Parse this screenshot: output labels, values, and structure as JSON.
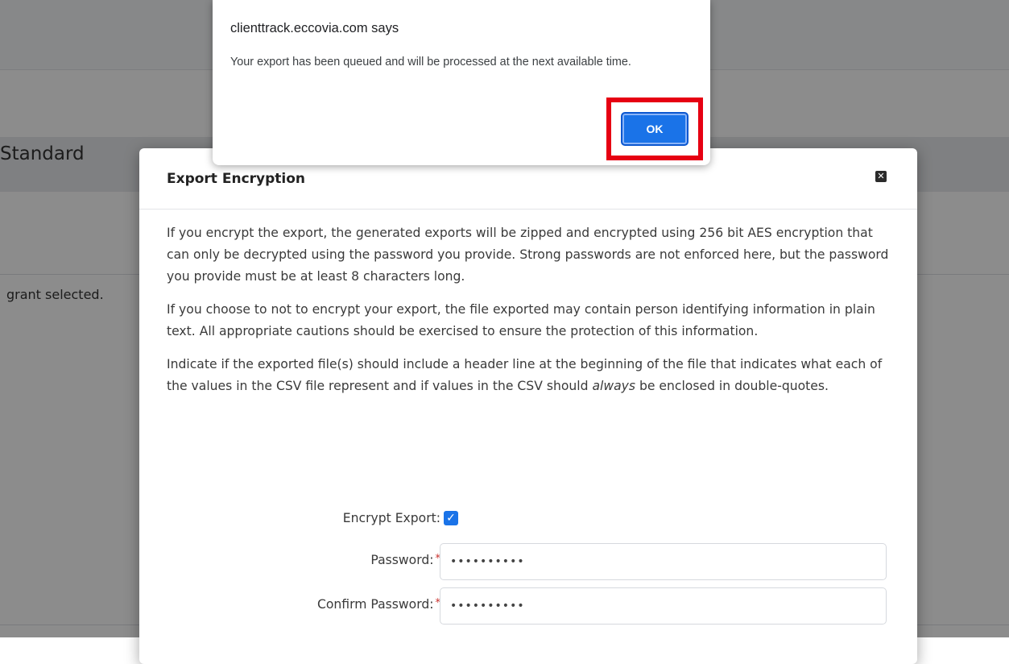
{
  "background": {
    "section_title": "Standard",
    "note_text": "grant selected."
  },
  "modal": {
    "title": "Export Encryption",
    "close_icon": "close-icon",
    "paragraphs": {
      "p1": "If you encrypt the export, the generated exports will be zipped and encrypted using 256 bit AES encryption that can only be decrypted using the password you provide. Strong passwords are not enforced here, but the password you provide must be at least 8 characters long.",
      "p2": "If you choose to not to encrypt your export, the file exported may contain person identifying information in plain text. All appropriate cautions should be exercised to ensure the protection of this information.",
      "p3_before": "Indicate if the exported file(s) should include a header line at the beginning of the file that indicates what each of the values in the CSV file represent and if values in the CSV should ",
      "p3_emphasis": "always",
      "p3_after": " be enclosed in double-quotes."
    },
    "form": {
      "encrypt_label": "Encrypt Export:",
      "encrypt_checked": true,
      "password_label": "Password:",
      "password_value": "••••••••••",
      "confirm_label": "Confirm Password:",
      "confirm_value": "••••••••••",
      "required_marker": "*"
    }
  },
  "alert": {
    "origin": "clienttrack.eccovia.com says",
    "message": "Your export has been queued and will be processed at the next available time.",
    "ok_label": "OK"
  },
  "colors": {
    "accent": "#1a73e8",
    "highlight": "#e60012",
    "required": "#c9302c"
  }
}
